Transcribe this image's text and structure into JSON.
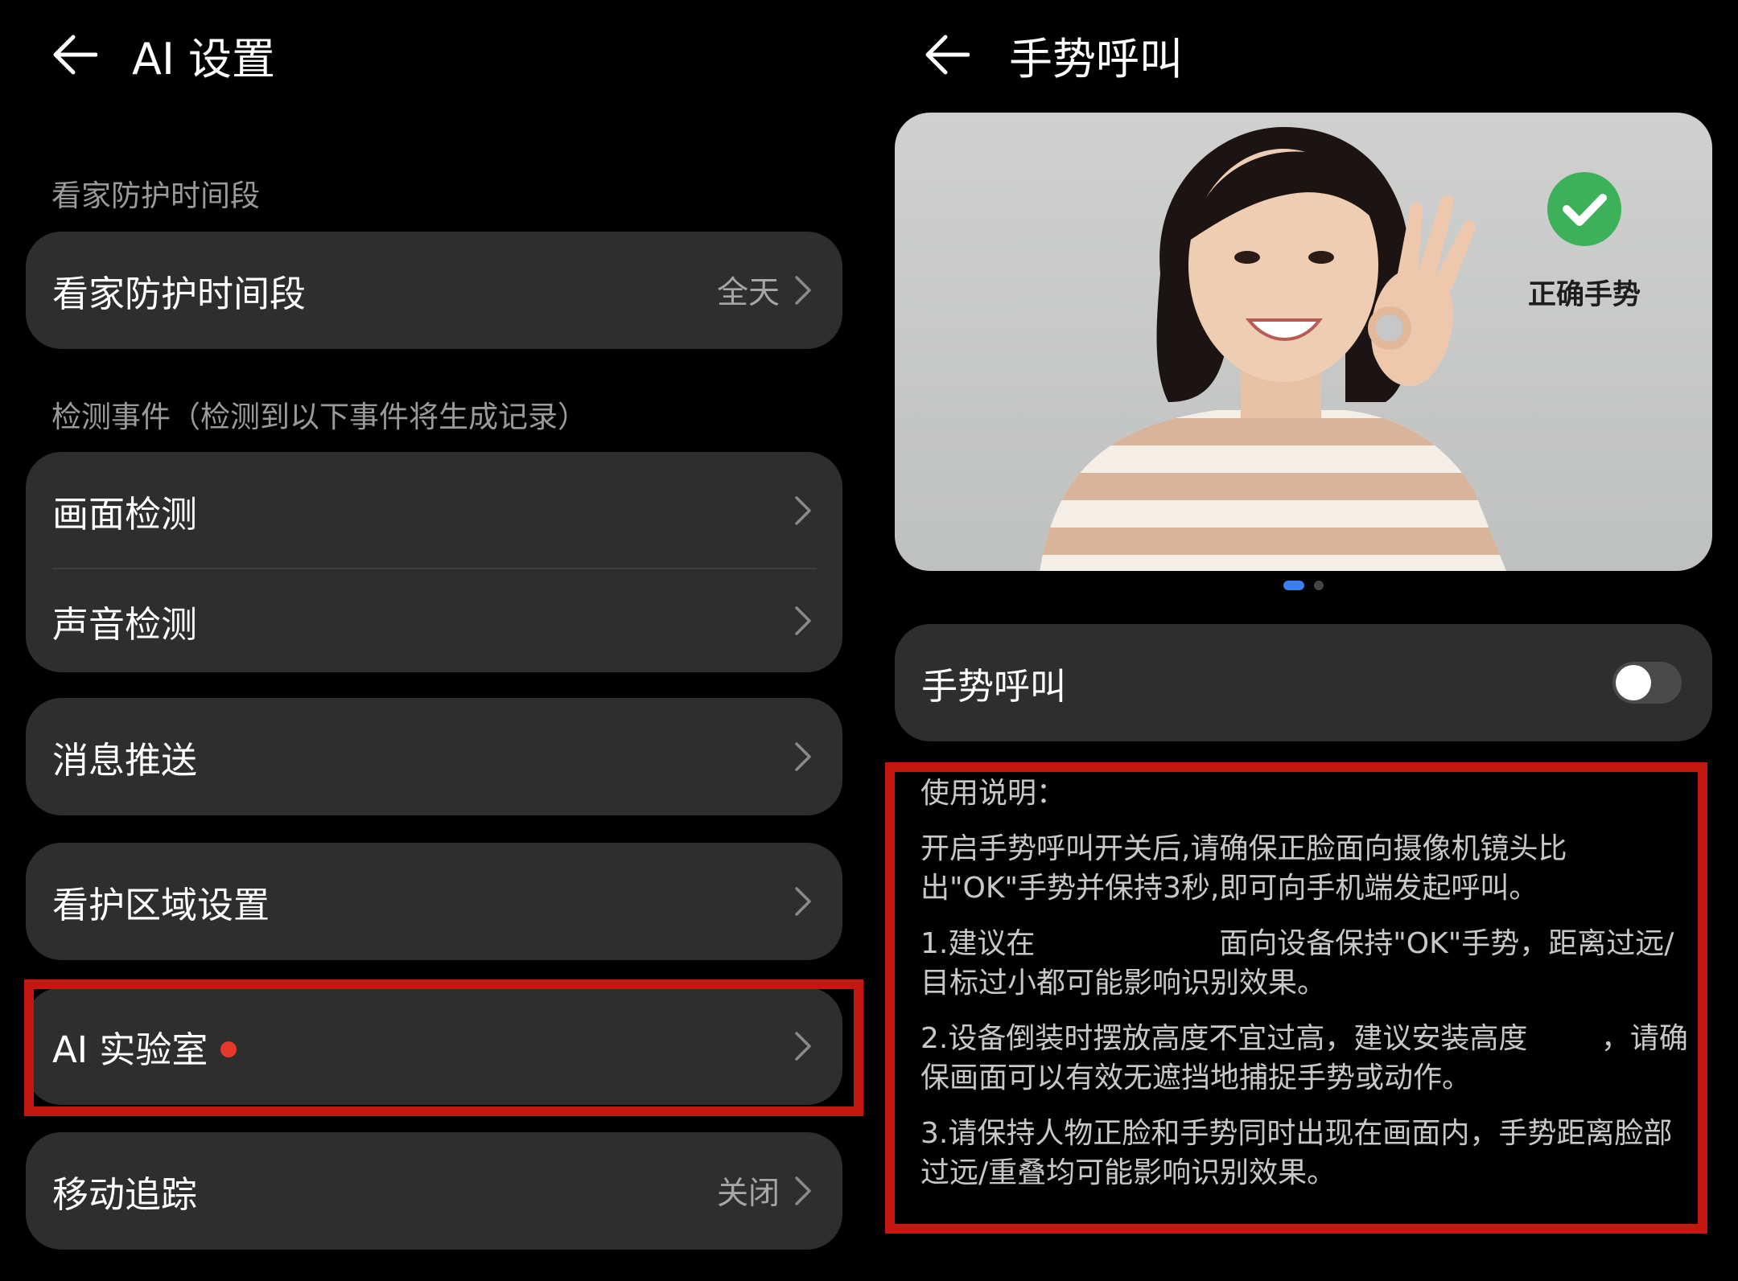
{
  "left": {
    "title": "AI 设置",
    "section1_label": "看家防护时间段",
    "row_protection": {
      "label": "看家防护时间段",
      "value": "全天"
    },
    "section2_label": "检测事件（检测到以下事件将生成记录）",
    "row_image": {
      "label": "画面检测"
    },
    "row_sound": {
      "label": "声音检测"
    },
    "row_push": {
      "label": "消息推送"
    },
    "row_area": {
      "label": "看护区域设置"
    },
    "row_lab": {
      "label": "AI 实验室",
      "has_badge": true
    },
    "row_motion": {
      "label": "移动追踪",
      "value": "关闭"
    }
  },
  "right": {
    "title": "手势呼叫",
    "photo_caption": "正确手势",
    "pager": {
      "count": 2,
      "active": 1
    },
    "toggle_row": {
      "label": "手势呼叫",
      "state": "off"
    },
    "instructions": {
      "heading": "使用说明：",
      "p1": "开启手势呼叫开关后,请确保正脸面向摄像机镜头比出\"OK\"手势并保持3秒,即可向手机端发起呼叫。",
      "p2": "1.建议在                    面向设备保持\"OK\"手势，距离过远/目标过小都可能影响识别效果。",
      "p3": "2.设备倒装时摆放高度不宜过高，建议安装高度        ，请确保画面可以有效无遮挡地捕捉手势或动作。",
      "p4": "3.请保持人物正脸和手势同时出现在画面内，手势距离脸部过远/重叠均可能影响识别效果。"
    }
  },
  "colors": {
    "highlight": "#c4170f",
    "badge": "#e33a2c",
    "check": "#3db05a",
    "pager_active": "#3c7ef0"
  }
}
